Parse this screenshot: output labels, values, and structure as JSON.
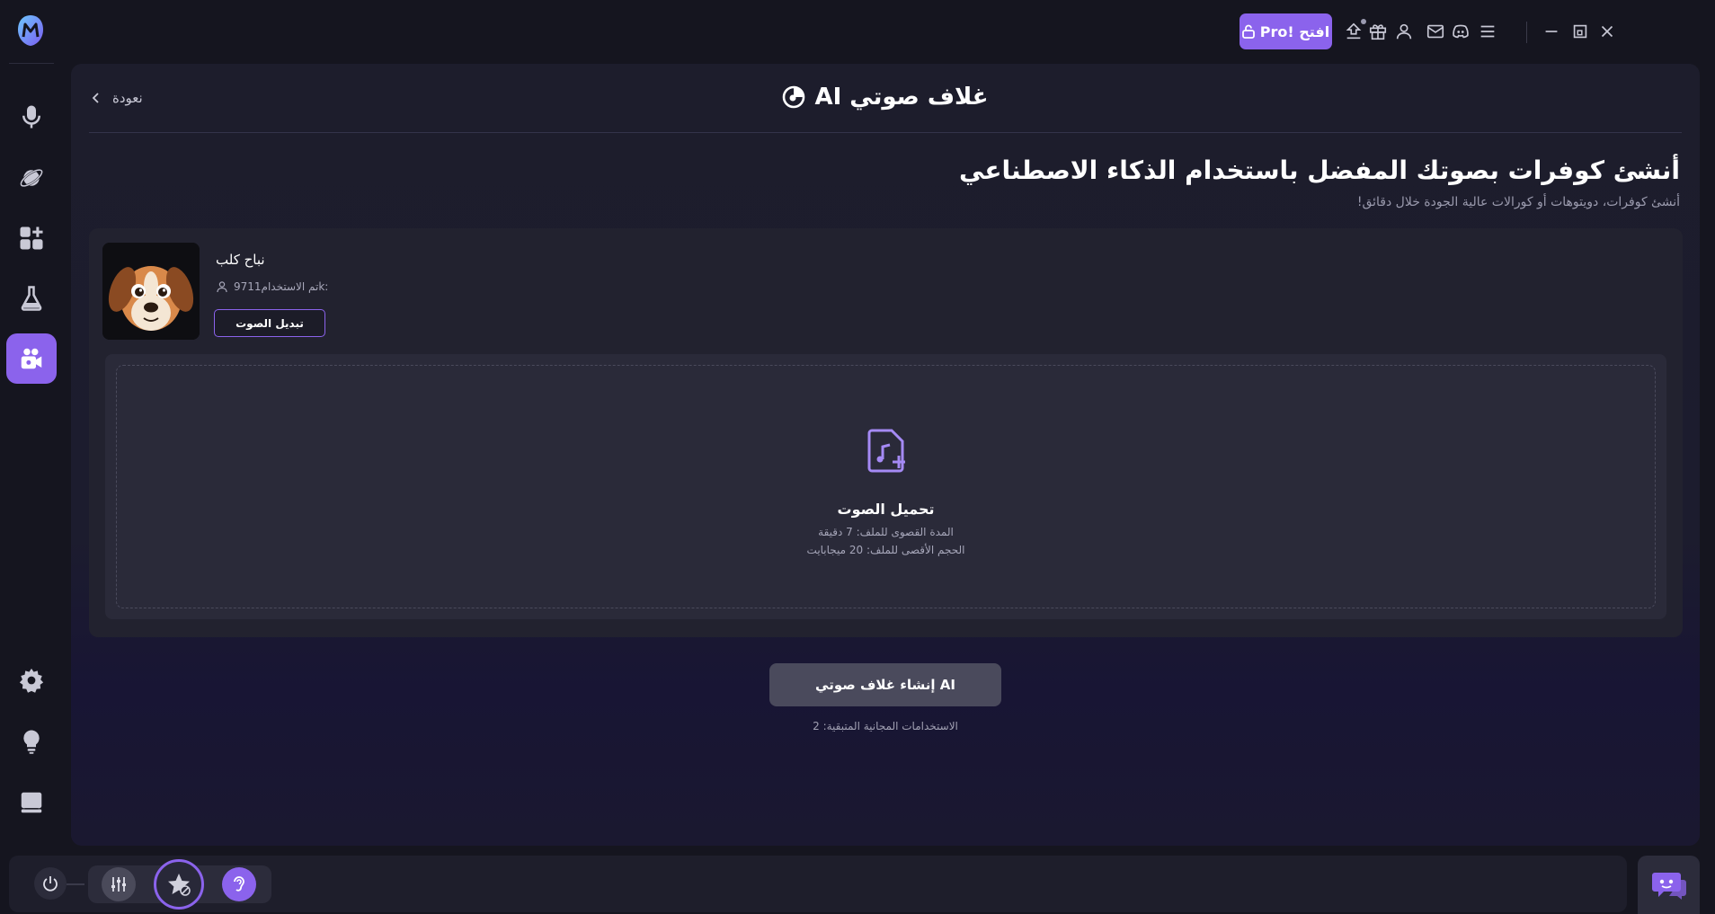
{
  "colors": {
    "accent": "#8b63ec",
    "background": "#15151f",
    "panel": "#1d1d2c"
  },
  "topbar": {
    "pro_label": "افتح !Pro",
    "icons": [
      "upgrade-icon",
      "gift-icon",
      "user-icon",
      "mail-icon",
      "discord-icon",
      "menu-icon",
      "minimize-icon",
      "restore-icon",
      "close-icon"
    ]
  },
  "sidebar": {
    "items": [
      {
        "name": "microphone",
        "icon": "microphone-icon"
      },
      {
        "name": "voice-planet",
        "icon": "planet-icon"
      },
      {
        "name": "apps",
        "icon": "apps-plus-icon"
      },
      {
        "name": "lab",
        "icon": "flask-icon"
      },
      {
        "name": "ai-cover",
        "icon": "camera-icon",
        "active": true
      },
      {
        "name": "settings",
        "icon": "gear-icon"
      },
      {
        "name": "tips",
        "icon": "lightbulb-icon"
      },
      {
        "name": "guide",
        "icon": "book-icon"
      }
    ]
  },
  "header": {
    "back_label": "نعودة",
    "title": "غلاف صوتي AI"
  },
  "intro": {
    "headline": "أنشئ كوفرات بصوتك المفضل باستخدام الذكاء الاصطناعي",
    "subline": "أنشئ كوفرات، دويتوهات أو كورالات عالية الجودة خلال دقائق!"
  },
  "voice": {
    "name": "نباح كلب",
    "usage": "تم الاستخدام9711k:",
    "change_label": "تبديل الصوت"
  },
  "upload": {
    "title": "تحميل الصوت",
    "max_duration": "المدة القصوى للملف: 7 دقيقة",
    "max_size": "الحجم الأقصى للملف: 20 ميجابايت"
  },
  "generate": {
    "label": "AI إنشاء غلاف صوتي",
    "free_uses": "الاستخدامات المجانية المتبقية: 2"
  }
}
